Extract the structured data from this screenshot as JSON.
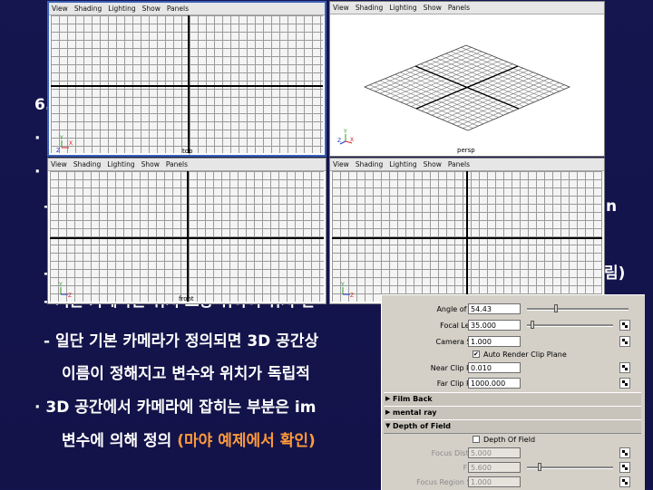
{
  "slide": {
    "heading_prefix": "6.",
    "bullet1_prefix": "·",
    "bullet2_prefix": "·",
    "dash1_prefix": "-",
    "dash2_prefix": "-",
    "partial_right1": "n",
    "partial_right2": "림)",
    "partial_line": "- 기본 카메라는 위치 보장 위하여 위치 변",
    "line_a": "- 일단 기본 카메라가 정의되면 3D 공간상",
    "line_b": "이름이 정해지고 변수와 위치가 독립적",
    "line_c": "· 3D 공간에서 카메라에 잡히는 부분은 im",
    "line_d_main": "변수에 의해 정의 ",
    "line_d_hl": "(마야 예제에서 확인)"
  },
  "viewports": [
    {
      "name": "top",
      "label": "top",
      "menu": [
        "View",
        "Shading",
        "Lighting",
        "Show",
        "Panels"
      ],
      "axes": "Y X Z"
    },
    {
      "name": "persp",
      "label": "persp",
      "menu": [
        "View",
        "Shading",
        "Lighting",
        "Show",
        "Panels"
      ],
      "axes": "Y Z X"
    },
    {
      "name": "front",
      "label": "front",
      "menu": [
        "View",
        "Shading",
        "Lighting",
        "Show",
        "Panels"
      ],
      "axes": "Y Z"
    },
    {
      "name": "side",
      "label": "side",
      "menu": [
        "View",
        "Shading",
        "Lighting",
        "Show",
        "Panels"
      ],
      "axes": "Y Z"
    }
  ],
  "panel": {
    "angle_of_view_label": "Angle of View",
    "angle_of_view": "54.43",
    "focal_length_label": "Focal Length",
    "focal_length": "35.000",
    "camera_scale_label": "Camera Scale",
    "camera_scale": "1.000",
    "auto_render_clip": "Auto Render Clip Plane",
    "near_clip_label": "Near Clip Plane",
    "near_clip": "0.010",
    "far_clip_label": "Far Clip Plane",
    "far_clip": "1000.000",
    "film_back": "Film Back",
    "mental_ray": "mental ray",
    "depth_of_field": "Depth of Field",
    "depth_of_field_check": "Depth Of Field",
    "focus_distance_label": "Focus Distance",
    "focus_distance": "5.000",
    "f_stop_label": "F Stop",
    "f_stop": "5.600",
    "focus_region_scale_label": "Focus Region Scale",
    "focus_region_scale": "1.000"
  }
}
